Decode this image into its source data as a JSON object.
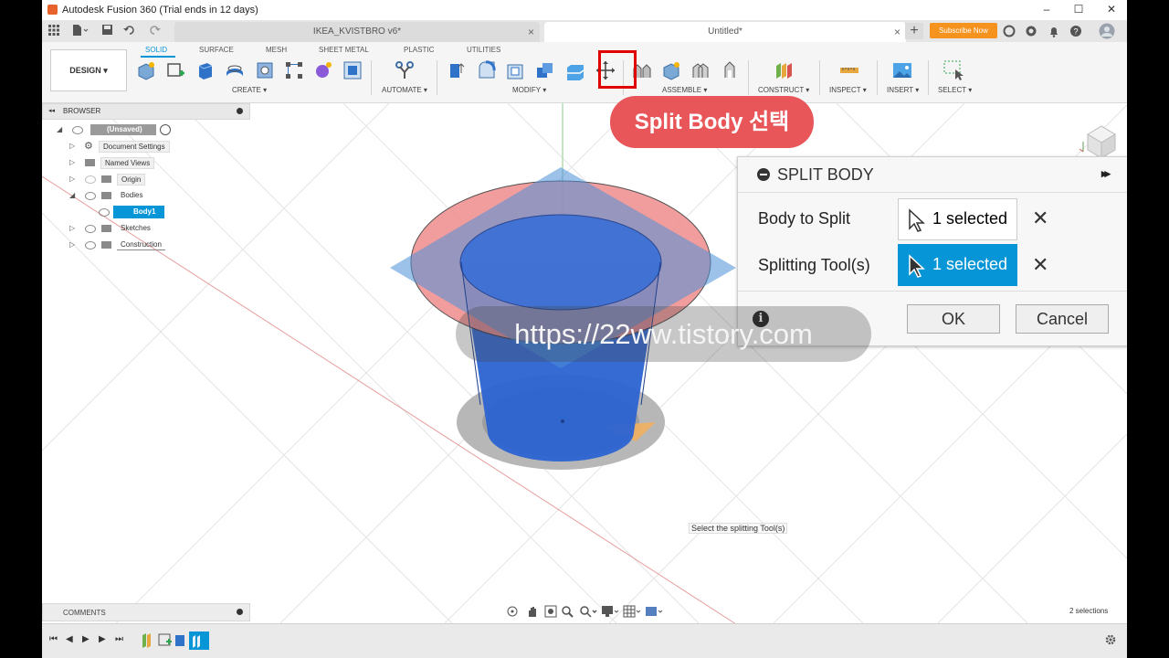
{
  "window": {
    "title": "Autodesk Fusion 360 (Trial ends in 12 days)",
    "controls": [
      "–",
      "☐",
      "✕"
    ]
  },
  "tabs": [
    {
      "label": "IKEA_KVISTBRO v6*",
      "close": "×"
    },
    {
      "label": "Untitled*",
      "close": "×"
    }
  ],
  "header": {
    "subscribe": "Subscribe Now"
  },
  "toolbar": {
    "workspace": "DESIGN ▾",
    "ribbon_tabs": [
      "SOLID",
      "SURFACE",
      "MESH",
      "SHEET METAL",
      "PLASTIC",
      "UTILITIES"
    ],
    "active_tab": "SOLID",
    "groups": {
      "create": "CREATE ▾",
      "automate": "AUTOMATE ▾",
      "modify": "MODIFY ▾",
      "assemble": "ASSEMBLE ▾",
      "construct": "CONSTRUCT ▾",
      "inspect": "INSPECT ▾",
      "insert": "INSERT ▾",
      "select": "SELECT ▾"
    }
  },
  "browser": {
    "title": "BROWSER",
    "root": "(Unsaved)",
    "items": [
      {
        "label": "Document Settings"
      },
      {
        "label": "Named Views"
      },
      {
        "label": "Origin"
      },
      {
        "label": "Bodies"
      },
      {
        "label": "Body1"
      },
      {
        "label": "Sketches"
      },
      {
        "label": "Construction"
      }
    ]
  },
  "callout": {
    "text": "Split Body 선택"
  },
  "dialog": {
    "title": "SPLIT BODY",
    "expand": "▸▸",
    "body_to_split": {
      "label": "Body to Split",
      "value": "1 selected"
    },
    "splitting_tools": {
      "label": "Splitting Tool(s)",
      "value": "1 selected"
    },
    "clear": "✕",
    "ok": "OK",
    "cancel": "Cancel"
  },
  "watermark": "https://22ww.tistory.com",
  "tooltip": "Select the splitting Tool(s)",
  "comments": {
    "title": "COMMENTS"
  },
  "status": {
    "selections": "2 selections"
  },
  "colors": {
    "accent": "#0696d7",
    "callout": "#e8565a",
    "highlight": "#e00000",
    "body": "#2c63d2",
    "disc": "#f08c8c",
    "plane": "#4a8fd8",
    "subscribe": "#f6921e"
  }
}
